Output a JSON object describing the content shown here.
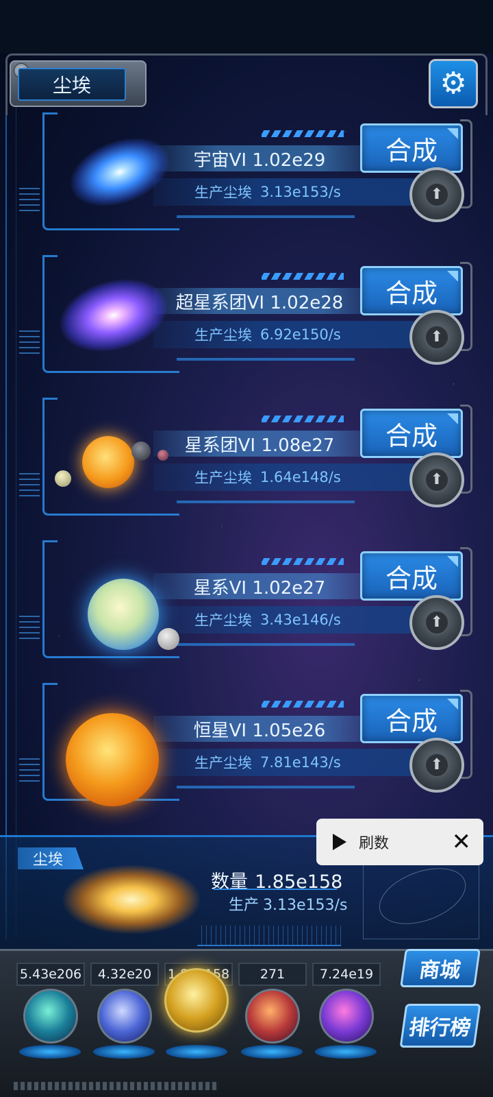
{
  "header": {
    "title": "尘埃",
    "settings_icon": "gear-icon"
  },
  "items": [
    {
      "name": "宇宙VI 1.02e29",
      "prod_label": "生产尘埃",
      "prod_value": "3.13e153/s",
      "merge_label": "合成",
      "image": "universe-nebula"
    },
    {
      "name": "超星系团VI 1.02e28",
      "prod_label": "生产尘埃",
      "prod_value": "6.92e150/s",
      "merge_label": "合成",
      "image": "supercluster-galaxy"
    },
    {
      "name": "星系团VI 1.08e27",
      "prod_label": "生产尘埃",
      "prod_value": "1.64e148/s",
      "merge_label": "合成",
      "image": "galaxy-cluster-planets"
    },
    {
      "name": "星系VI 1.02e27",
      "prod_label": "生产尘埃",
      "prod_value": "3.43e146/s",
      "merge_label": "合成",
      "image": "galaxy-planet"
    },
    {
      "name": "恒星VI 1.05e26",
      "prod_label": "生产尘埃",
      "prod_value": "7.81e143/s",
      "merge_label": "合成",
      "image": "star-sun"
    }
  ],
  "dust": {
    "tag": "尘埃",
    "count_label": "数量",
    "count_value": "1.85e158",
    "rate_label": "生产",
    "rate_value": "3.13e153/s"
  },
  "toast": {
    "label": "刷数"
  },
  "resources": [
    {
      "value": "5.43e206",
      "icon": "molecule-orb-icon"
    },
    {
      "value": "4.32e20",
      "icon": "lightning-orb-icon"
    },
    {
      "value": "1.85e158",
      "icon": "dust-orb-icon"
    },
    {
      "value": "271",
      "icon": "brain-orb-icon"
    },
    {
      "value": "7.24e19",
      "icon": "vortex-orb-icon"
    }
  ],
  "side_buttons": {
    "shop": "商城",
    "ranking": "排行榜"
  },
  "colors": {
    "accent": "#2a86e0",
    "button": "#1f7ad8",
    "text_light": "#eaf5ff",
    "text_prod": "#7fc4ff"
  }
}
